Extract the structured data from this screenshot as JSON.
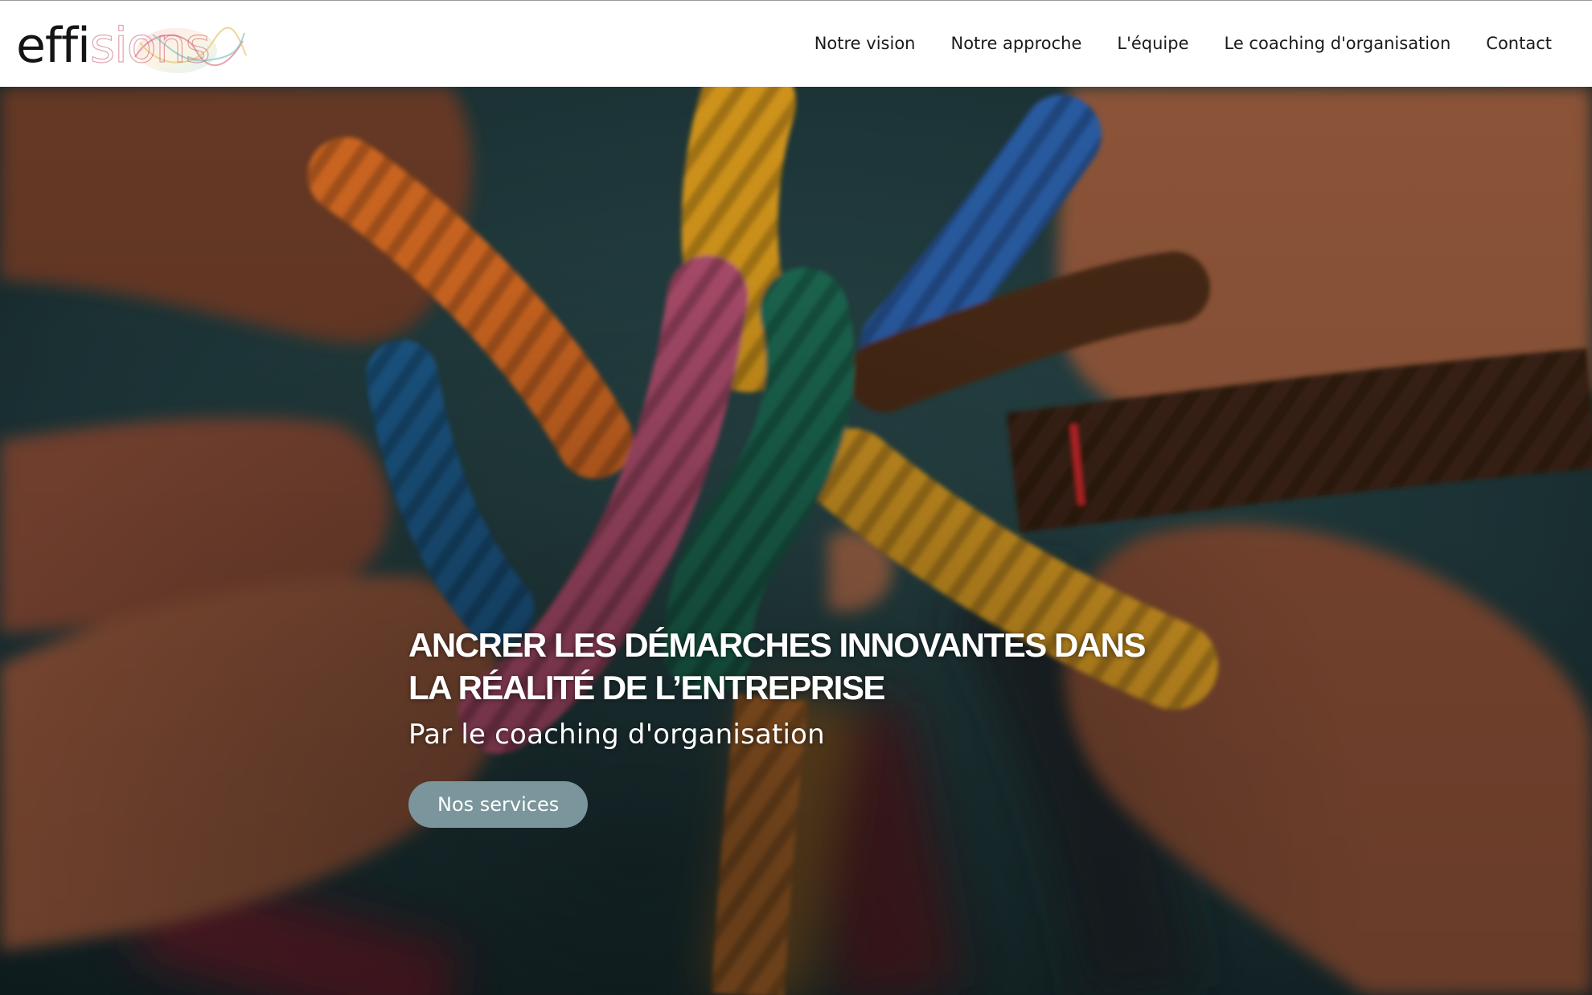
{
  "brand": {
    "logo_dark": "effi",
    "logo_color": "sions"
  },
  "nav": {
    "items": [
      {
        "label": "Notre vision"
      },
      {
        "label": "Notre approche"
      },
      {
        "label": "L'équipe"
      },
      {
        "label": "Le coaching d'organisation"
      },
      {
        "label": "Contact"
      }
    ]
  },
  "hero": {
    "title_line1": "ANCRER LES DÉMARCHES INNOVANTES DANS",
    "title_line2": "LA RÉALITÉ DE L’ENTREPRISE",
    "subtitle": "Par le coaching d'organisation",
    "cta_label": "Nos services"
  },
  "colors": {
    "header_bg": "#ffffff",
    "cta_bg": "#7a959b",
    "hero_text": "#ffffff"
  }
}
